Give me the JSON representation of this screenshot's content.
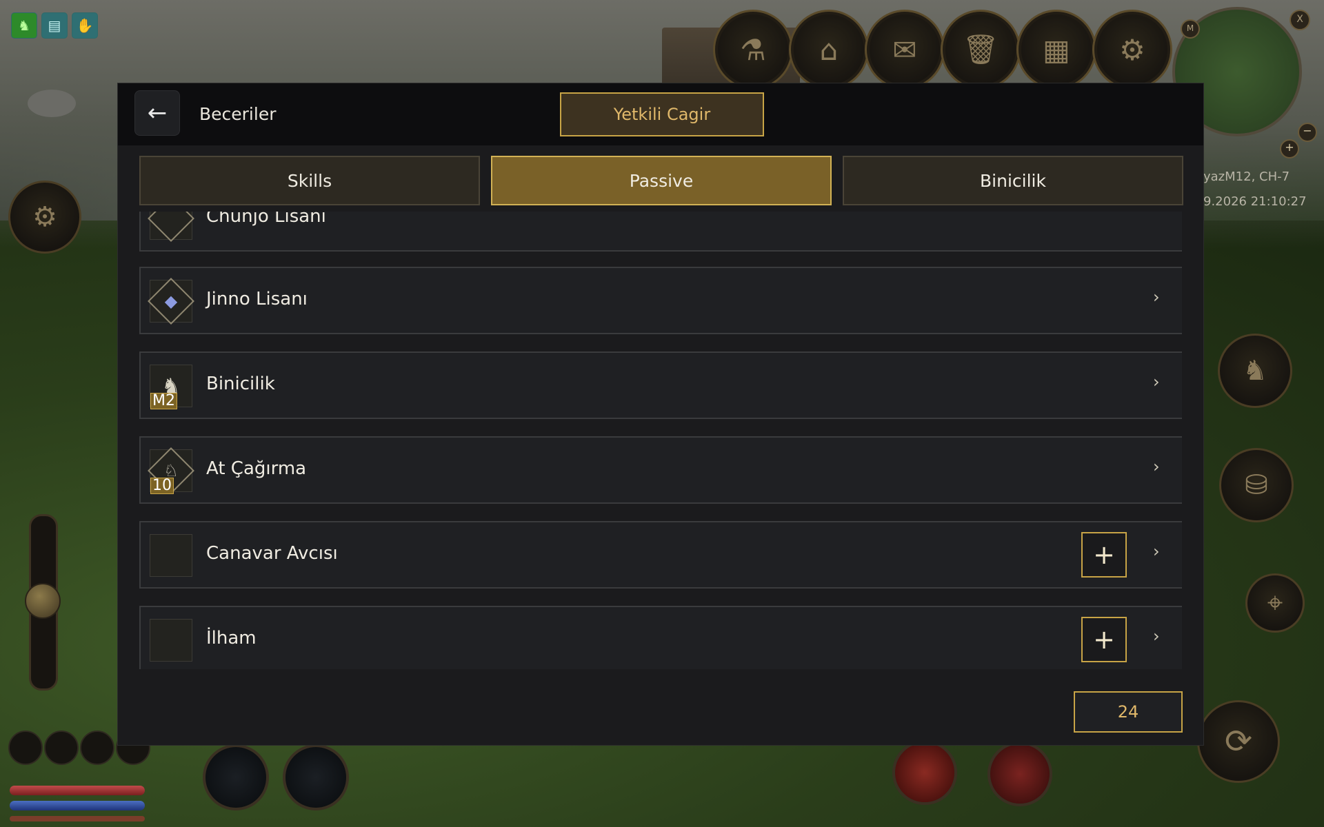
{
  "hud": {
    "buffs": [
      "horse-buff-icon",
      "scroll-buff-icon",
      "hand-buff-icon"
    ],
    "server_info": "yazM12, CH-7",
    "server_time": "9.2026 21:10:27",
    "minimap": {
      "m_label": "M",
      "close_label": "X",
      "zoom_in": "+",
      "zoom_out": "−"
    }
  },
  "modal": {
    "title": "Beceriler",
    "gm_button": "Yetkili Cagir",
    "tabs": [
      {
        "label": "Skills",
        "active": false
      },
      {
        "label": "Passive",
        "active": true
      },
      {
        "label": "Binicilik",
        "active": false
      }
    ],
    "rows": [
      {
        "label": "Chunjo Lisanı",
        "icon": "language-book-icon",
        "badge": "",
        "has_plus": false
      },
      {
        "label": "Jinno Lisanı",
        "icon": "language-book-icon",
        "badge": "",
        "has_plus": false
      },
      {
        "label": "Binicilik",
        "icon": "white-horse-icon",
        "badge": "M2",
        "has_plus": false
      },
      {
        "label": "At Çağırma",
        "icon": "horse-call-icon",
        "badge": "10",
        "has_plus": false
      },
      {
        "label": "Canavar Avcısı",
        "icon": "",
        "badge": "",
        "has_plus": true
      },
      {
        "label": "İlham",
        "icon": "",
        "badge": "",
        "has_plus": true
      }
    ],
    "skill_points": "24"
  },
  "colors": {
    "accent_gold": "#c8a446",
    "active_tab": "#7a6128",
    "panel_bg": "#1b1b1d",
    "row_bg": "#1f2023"
  }
}
